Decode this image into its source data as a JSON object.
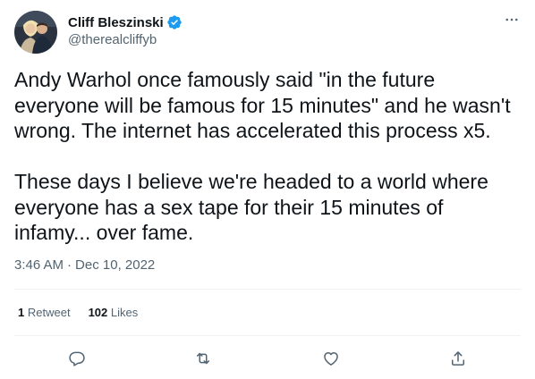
{
  "author": {
    "display_name": "Cliff Bleszinski",
    "handle": "@therealcliffyb",
    "verified": true
  },
  "tweet": {
    "text": "Andy Warhol once famously said \"in the future everyone will be famous for 15 minutes\" and he wasn't wrong. The internet has accelerated this process x5.\n\nThese days I believe we're headed to a world where everyone has a sex tape for their 15 minutes of infamy... over fame.",
    "time": "3:46 AM",
    "separator": "·",
    "date": "Dec 10, 2022"
  },
  "stats": {
    "retweets_count": "1",
    "retweets_label": "Retweet",
    "likes_count": "102",
    "likes_label": "Likes"
  },
  "icons": {
    "more": "more-horizontal-icon",
    "reply": "reply-icon",
    "retweet": "retweet-icon",
    "like": "like-icon",
    "share": "share-icon",
    "verified": "verified-badge-icon"
  },
  "colors": {
    "text": "#0f1419",
    "secondary": "#536471",
    "verified": "#1d9bf0",
    "divider": "#eff3f4"
  }
}
